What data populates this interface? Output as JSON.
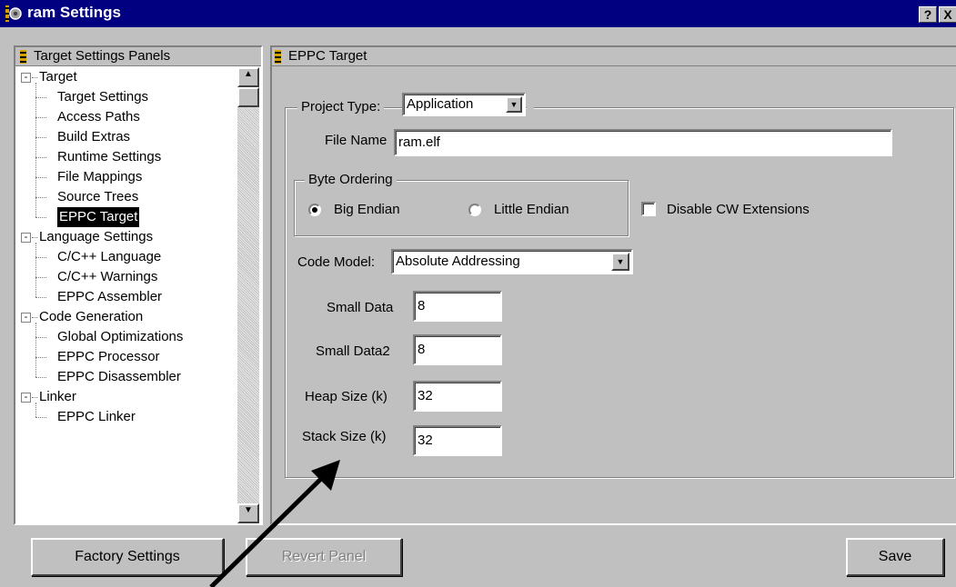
{
  "window": {
    "title": "ram Settings",
    "help_button": "?",
    "close_button": "X"
  },
  "left_panel": {
    "header": "Target Settings Panels",
    "tree": [
      {
        "label": "Target",
        "level": 0,
        "expander": "-"
      },
      {
        "label": "Target Settings",
        "level": 1
      },
      {
        "label": "Access Paths",
        "level": 1
      },
      {
        "label": "Build Extras",
        "level": 1
      },
      {
        "label": "Runtime Settings",
        "level": 1
      },
      {
        "label": "File Mappings",
        "level": 1
      },
      {
        "label": "Source Trees",
        "level": 1
      },
      {
        "label": "EPPC Target",
        "level": 1,
        "selected": true
      },
      {
        "label": "Language Settings",
        "level": 0,
        "expander": "-"
      },
      {
        "label": "C/C++ Language",
        "level": 1
      },
      {
        "label": "C/C++ Warnings",
        "level": 1
      },
      {
        "label": "EPPC Assembler",
        "level": 1
      },
      {
        "label": "Code Generation",
        "level": 0,
        "expander": "-"
      },
      {
        "label": "Global Optimizations",
        "level": 1
      },
      {
        "label": "EPPC Processor",
        "level": 1
      },
      {
        "label": "EPPC Disassembler",
        "level": 1
      },
      {
        "label": "Linker",
        "level": 0,
        "expander": "-"
      },
      {
        "label": "EPPC Linker",
        "level": 1
      }
    ]
  },
  "right_panel": {
    "header": "EPPC Target",
    "project_type_label": "Project Type:",
    "project_type_value": "Application",
    "file_name_label": "File Name",
    "file_name_value": "ram.elf",
    "byte_ordering_label": "Byte Ordering",
    "big_endian_label": "Big Endian",
    "big_endian_selected": true,
    "little_endian_label": "Little Endian",
    "disable_cw_label": "Disable CW Extensions",
    "disable_cw_checked": false,
    "code_model_label": "Code Model:",
    "code_model_value": "Absolute Addressing",
    "small_data_label": "Small Data",
    "small_data_value": "8",
    "small_data2_label": "Small Data2",
    "small_data2_value": "8",
    "heap_size_label": "Heap Size (k)",
    "heap_size_value": "32",
    "stack_size_label": "Stack Size (k)",
    "stack_size_value": "32"
  },
  "buttons": {
    "factory_settings": "Factory Settings",
    "revert_panel": "Revert Panel",
    "save": "Save"
  },
  "colors": {
    "titlebar": "#000080",
    "face": "#c0c0c0",
    "selection": "#000000",
    "annotation_arrow": "#000000"
  }
}
